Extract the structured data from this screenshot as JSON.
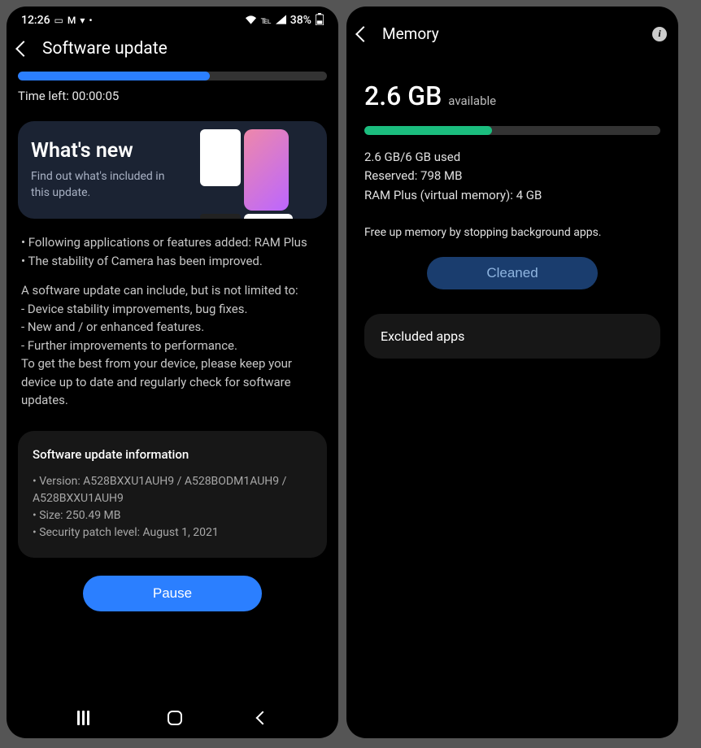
{
  "left": {
    "status": {
      "time": "12:26",
      "battery": "38%"
    },
    "header": {
      "title": "Software update"
    },
    "progress": {
      "percent": 62,
      "time_left": "Time left: 00:00:05"
    },
    "whats_new": {
      "title": "What's new",
      "subtitle": "Find out what's included in this update."
    },
    "changelog": {
      "line1": "• Following applications or features added: RAM Plus",
      "line2": "• The stability of Camera has been improved.",
      "intro": "A software update can include, but is not limited to:",
      "b1": " - Device stability improvements, bug fixes.",
      "b2": " - New and / or enhanced features.",
      "b3": " - Further improvements to performance.",
      "outro": "To get the best from your device, please keep your device up to date and regularly check for software updates."
    },
    "info": {
      "title": "Software update information",
      "version": "• Version: A528BXXU1AUH9 / A528BODM1AUH9 / A528BXXU1AUH9",
      "size": "• Size: 250.49 MB",
      "patch": "• Security patch level: August 1, 2021"
    },
    "pause_label": "Pause"
  },
  "right": {
    "header": {
      "title": "Memory"
    },
    "headline": {
      "value": "2.6",
      "unit": "GB",
      "suffix": "available"
    },
    "progress": {
      "percent": 43
    },
    "details": {
      "used": "2.6 GB/6 GB used",
      "reserved": "Reserved: 798 MB",
      "ram_plus": "RAM Plus (virtual memory): 4 GB"
    },
    "tip": "Free up memory by stopping background apps.",
    "cleaned_label": "Cleaned",
    "excluded_label": "Excluded apps"
  }
}
